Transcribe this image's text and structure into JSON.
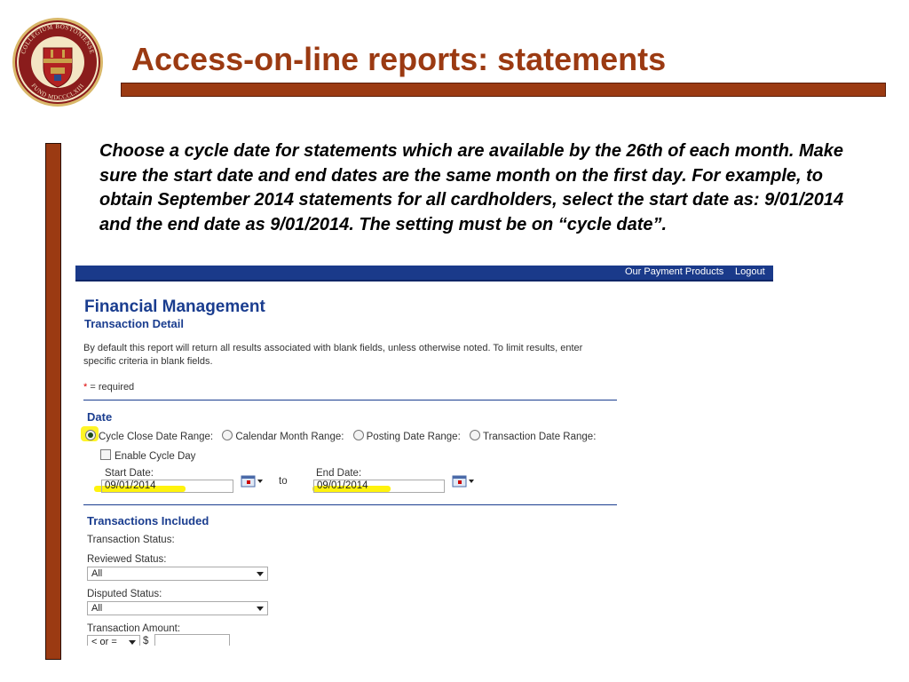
{
  "slide": {
    "title": "Access-on-line reports: statements",
    "intro": "Choose a cycle date for statements which are available by the 26th of each month. Make sure the start date and end dates are the same month on the first day. For example, to obtain September 2014 statements for all cardholders, select the start date as: 9/01/2014 and the end date as 9/01/2014. The setting must be on “cycle date”.",
    "seal": {
      "text_top": "COLLEGIUM BOSTONIENSE",
      "text_bottom": "FUND MDCCCLXIII",
      "colors": {
        "ring": "#8a1c1c",
        "gold": "#c9a24a",
        "shield": "#b22222"
      }
    },
    "accent_color": "#9b3a12"
  },
  "app": {
    "nav": {
      "links": [
        "Our Payment Products",
        "Logout"
      ],
      "color": "#1a3a8a"
    },
    "title": "Financial Management",
    "subtitle": "Transaction Detail",
    "description": "By default this report will return all results associated with blank fields, unless otherwise noted. To limit results, enter specific criteria in blank fields.",
    "required_star": "*",
    "required_text": " = required",
    "date_section": {
      "title": "Date",
      "radios": [
        {
          "label": "Cycle Close Date Range:",
          "selected": true
        },
        {
          "label": "Calendar Month Range:",
          "selected": false
        },
        {
          "label": "Posting Date Range:",
          "selected": false
        },
        {
          "label": "Transaction Date Range:",
          "selected": false
        }
      ],
      "enable_cycle_day": "Enable Cycle Day",
      "start_label": "Start Date:",
      "start_value": "09/01/2014",
      "to": "to",
      "end_label": "End Date:",
      "end_value": "09/01/2014",
      "calendar_icon": "calendar-icon",
      "highlight_color": "#fff200"
    },
    "transactions_section": {
      "title": "Transactions Included",
      "status_label": "Transaction Status:",
      "reviewed_label": "Reviewed Status:",
      "reviewed_value": "All",
      "disputed_label": "Disputed Status:",
      "disputed_value": "All",
      "amount_label": "Transaction Amount:",
      "amount_operator": "< or =",
      "currency": "$",
      "amount_value": ""
    }
  }
}
